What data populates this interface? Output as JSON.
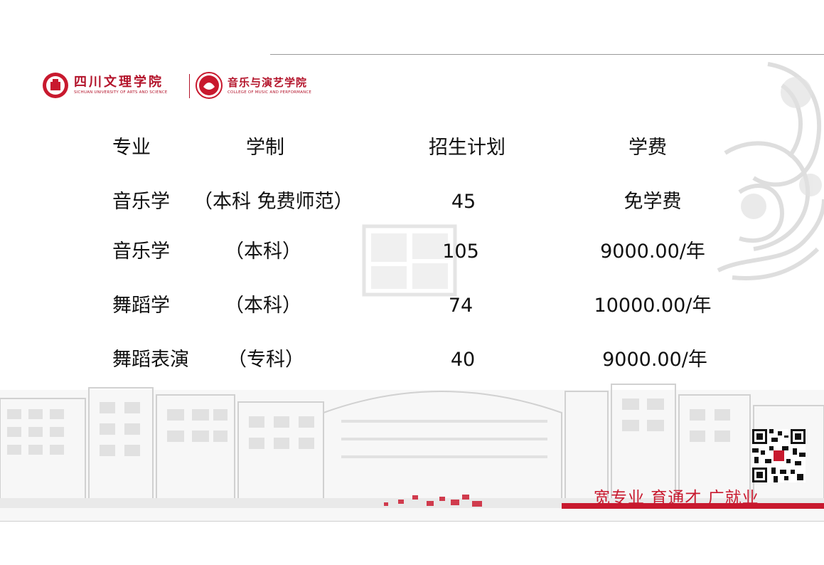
{
  "brand": {
    "university_cn": "四川文理学院",
    "university_en": "SICHUAN UNIVERSITY OF ARTS AND SCIENCE",
    "college_cn": "音乐与演艺学院",
    "college_en": "COLLEGE OF MUSIC AND PERFORMANCE",
    "accent_color": "#c8192e"
  },
  "table": {
    "headers": {
      "major": "专业",
      "system": "学制",
      "plan": "招生计划",
      "fee": "学费"
    },
    "rows": [
      {
        "major": "音乐学",
        "system": "（本科 免费师范）",
        "plan": "45",
        "fee": "免学费"
      },
      {
        "major": "音乐学",
        "system": "（本科）",
        "plan": "105",
        "fee": "9000.00/年"
      },
      {
        "major": "舞蹈学",
        "system": "（本科）",
        "plan": "74",
        "fee": "10000.00/年"
      },
      {
        "major": "舞蹈表演",
        "system": "（专科）",
        "plan": "40",
        "fee": "9000.00/年"
      }
    ]
  },
  "footer": {
    "slogan": "宽专业 育通才 广就业"
  }
}
